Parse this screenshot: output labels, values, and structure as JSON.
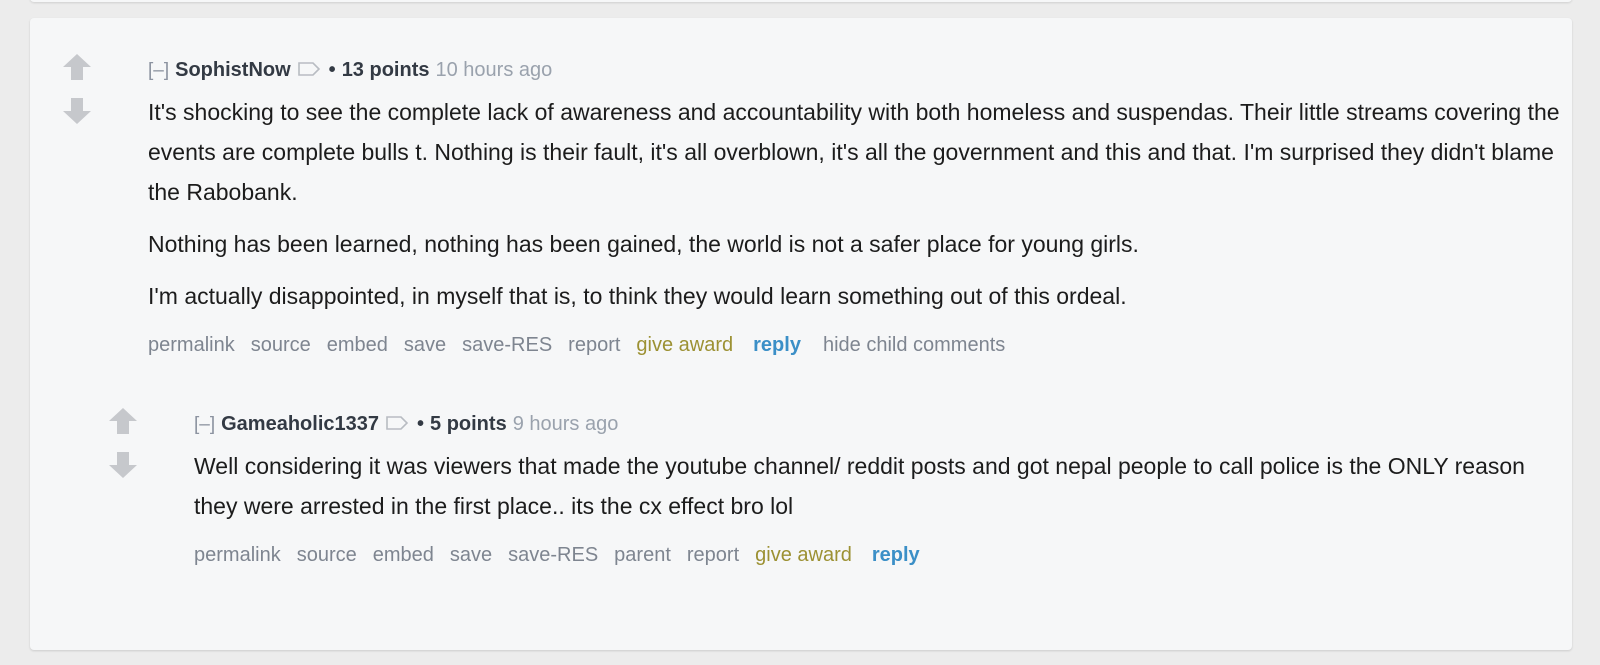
{
  "colors": {
    "background": "#ececec",
    "card": "#f6f7f8",
    "arrow": "#c6c8cc",
    "author": "#333a44",
    "muted": "#7e8590",
    "award": "#9c9133",
    "reply": "#3b8fc7"
  },
  "comments": [
    {
      "collapse": "[–]",
      "author": "SophistNow",
      "bullet": "•",
      "score": "13 points",
      "time": "10 hours ago",
      "icons": {
        "upvote": "arrow-up-icon",
        "downvote": "arrow-down-icon",
        "flair": "tag-icon"
      },
      "paragraphs": [
        "It's shocking to see the complete lack of awareness and accountability with both homeless and suspendas. Their little streams covering the events are complete bulls   t. Nothing is their fault, it's all overblown, it's all the government and this and that. I'm surprised they didn't blame the Rabobank.",
        "Nothing has been learned, nothing has been gained, the world is not a safer place for young girls.",
        "I'm actually disappointed, in myself that is, to think they would learn something out of this ordeal."
      ],
      "buttons": {
        "permalink": "permalink",
        "source": "source",
        "embed": "embed",
        "save": "save",
        "save_res": "save-RES",
        "report": "report",
        "give_award": "give award",
        "reply": "reply",
        "hide_child": "hide child comments"
      }
    },
    {
      "collapse": "[–]",
      "author": "Gameaholic1337",
      "bullet": "•",
      "score": "5 points",
      "time": "9 hours ago",
      "icons": {
        "upvote": "arrow-up-icon",
        "downvote": "arrow-down-icon",
        "flair": "tag-icon"
      },
      "paragraphs": [
        "Well considering it was viewers that made the youtube channel/ reddit posts and got nepal people to call police is the ONLY reason they were arrested in the first place.. its the cx effect bro lol"
      ],
      "buttons": {
        "permalink": "permalink",
        "source": "source",
        "embed": "embed",
        "save": "save",
        "save_res": "save-RES",
        "parent": "parent",
        "report": "report",
        "give_award": "give award",
        "reply": "reply"
      }
    }
  ]
}
